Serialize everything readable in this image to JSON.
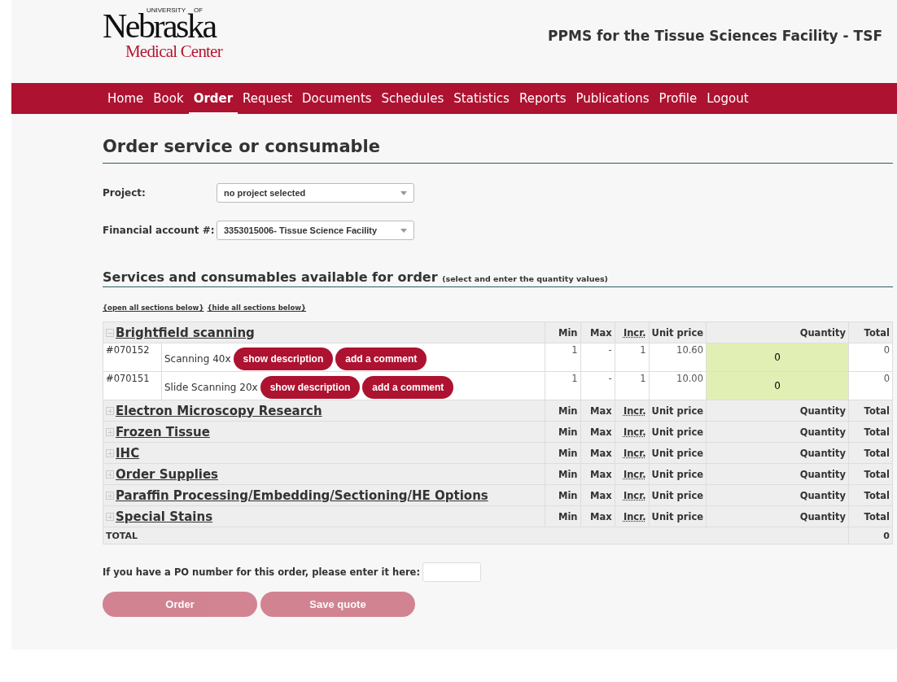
{
  "logo": {
    "top_left": "UNIVERSITY",
    "top_right": "OF",
    "main": "Nebraska",
    "sub": "Medical Center"
  },
  "site_title": "PPMS for the Tissue Sciences Facility - TSF",
  "nav": [
    {
      "label": "Home",
      "selected": false
    },
    {
      "label": "Book",
      "selected": false
    },
    {
      "label": "Order",
      "selected": true
    },
    {
      "label": "Request",
      "selected": false
    },
    {
      "label": "Documents",
      "selected": false
    },
    {
      "label": "Schedules",
      "selected": false
    },
    {
      "label": "Statistics",
      "selected": false
    },
    {
      "label": "Reports",
      "selected": false
    },
    {
      "label": "Publications",
      "selected": false
    },
    {
      "label": "Profile",
      "selected": false
    },
    {
      "label": "Logout",
      "selected": false
    }
  ],
  "page_title": "Order service or consumable",
  "fields": [
    {
      "label": "Project:",
      "value": "no project selected"
    },
    {
      "label": "Financial account #:",
      "value": "3353015006- Tissue Science Facility"
    }
  ],
  "section_title": "Services and consumables available for order",
  "section_hint": "(select and enter the quantity values)",
  "section_links": [
    "{open all sections below}",
    "{hide all sections below}"
  ],
  "table": {
    "sections": [
      {
        "name": "Brightfield scanning",
        "expanded": true,
        "columns": [
          "Min",
          "Max",
          "Incr.",
          "Unit price",
          "Quantity",
          "Total"
        ],
        "items": [
          {
            "id": "#070152",
            "name": "Scanning 40x",
            "buttons": [
              "show description",
              "add a comment"
            ],
            "min": "1",
            "max": "-",
            "incr": "1",
            "unit_price": "10.60",
            "quantity": "0",
            "total": "0"
          },
          {
            "id": "#070151",
            "name": "Slide Scanning 20x",
            "buttons": [
              "show description",
              "add a comment"
            ],
            "min": "1",
            "max": "-",
            "incr": "1",
            "unit_price": "10.00",
            "quantity": "0",
            "total": "0"
          }
        ]
      },
      {
        "name": "Electron Microscopy Research",
        "expanded": false,
        "columns": [
          "Min",
          "Max",
          "Incr.",
          "Unit price",
          "Quantity",
          "Total"
        ]
      },
      {
        "name": "Frozen Tissue",
        "expanded": false,
        "columns": [
          "Min",
          "Max",
          "Incr.",
          "Unit price",
          "Quantity",
          "Total"
        ]
      },
      {
        "name": "IHC",
        "expanded": false,
        "columns": [
          "Min",
          "Max",
          "Incr.",
          "Unit price",
          "Quantity",
          "Total"
        ]
      },
      {
        "name": "Order Supplies",
        "expanded": false,
        "columns": [
          "Min",
          "Max",
          "Incr.",
          "Unit price",
          "Quantity",
          "Total"
        ]
      },
      {
        "name": "Paraffin Processing/Embedding/Sectioning/HE Options",
        "expanded": false,
        "columns": [
          "Min",
          "Max",
          "Incr.",
          "Unit price",
          "Quantity",
          "Total"
        ]
      },
      {
        "name": "Special Stains",
        "expanded": false,
        "columns": [
          "Min",
          "Max",
          "Incr.",
          "Unit price",
          "Quantity",
          "Total"
        ]
      }
    ],
    "total_label": "TOTAL",
    "total_value": "0"
  },
  "po_label": "If you have a PO number for this order, please enter it here:",
  "actions": [
    {
      "label": "Order",
      "disabled": true
    },
    {
      "label": "Save quote",
      "disabled": true
    }
  ]
}
